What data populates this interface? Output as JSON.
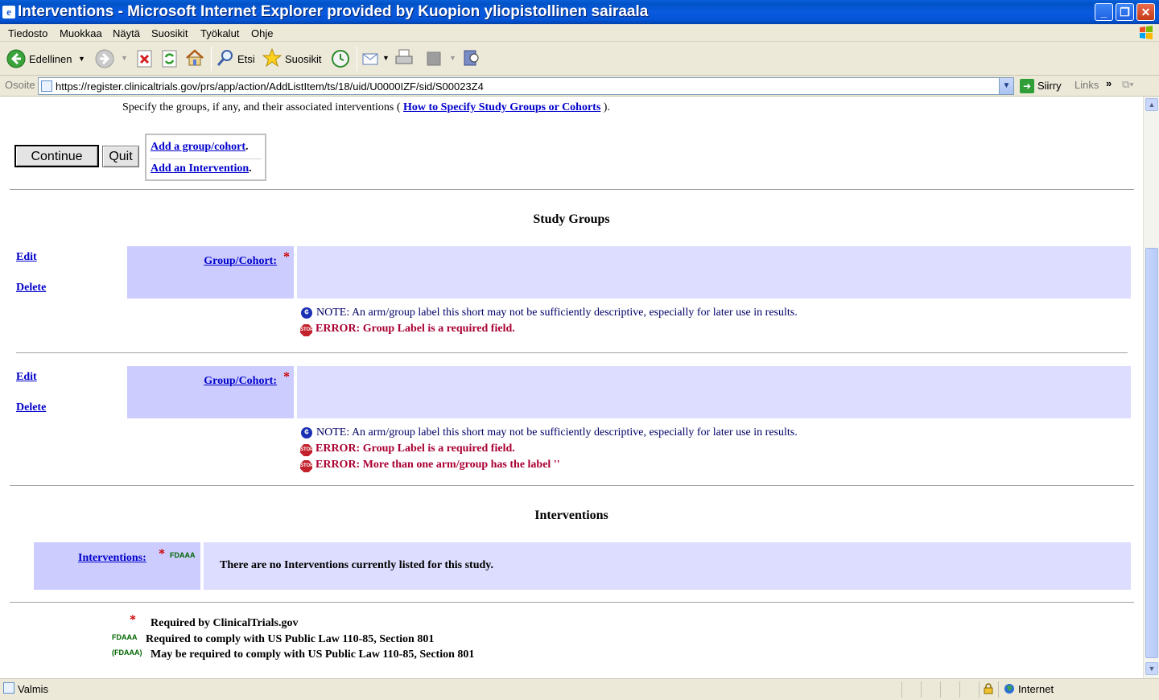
{
  "window": {
    "title": "Interventions - Microsoft Internet Explorer provided by Kuopion yliopistollinen sairaala"
  },
  "menu": [
    "Tiedosto",
    "Muokkaa",
    "Näytä",
    "Suosikit",
    "Työkalut",
    "Ohje"
  ],
  "toolbar": {
    "back_label": "Edellinen",
    "search_label": "Etsi",
    "favorites_label": "Suosikit"
  },
  "address": {
    "label": "Osoite",
    "url": "https://register.clinicaltrials.gov/prs/app/action/AddListItem/ts/18/uid/U0000IZF/sid/S00023Z4",
    "go_label": "Siirry",
    "links_label": "Links"
  },
  "page": {
    "intro_text": "Specify the groups, if any, and their associated interventions (",
    "intro_link": "How to Specify Study Groups or Cohorts",
    "intro_end": ").",
    "continue_label": "Continue",
    "quit_label": "Quit",
    "add_group_link": "Add a group/cohort",
    "add_intervention_link": "Add an Intervention",
    "period": ".",
    "study_groups_title": "Study Groups",
    "groups": [
      {
        "edit_label": "Edit",
        "delete_label": "Delete",
        "field_label": "Group/Cohort:",
        "required_mark": "*",
        "value": "",
        "note": "NOTE: An arm/group label this short may not be sufficiently descriptive, especially for later use in results.",
        "errors": [
          "ERROR: Group Label is a required field."
        ]
      },
      {
        "edit_label": "Edit",
        "delete_label": "Delete",
        "field_label": "Group/Cohort:",
        "required_mark": "*",
        "value": "",
        "note": "NOTE: An arm/group label this short may not be sufficiently descriptive, especially for later use in results.",
        "errors": [
          "ERROR: Group Label is a required field.",
          "ERROR: More than one arm/group has the label ''"
        ]
      }
    ],
    "interventions_title": "Interventions",
    "interventions_label": "Interventions:",
    "interventions_required": "*",
    "interventions_fdaaa": "FDAAA",
    "interventions_empty": "There are no Interventions currently listed for this study.",
    "legend": {
      "required_mark": "*",
      "required_text": "Required by ClinicalTrials.gov",
      "fdaaa_mark": "FDAAA",
      "fdaaa_text": "Required to comply with US Public Law 110-85, Section 801",
      "fdaaa_opt_mark": "(FDAAA)",
      "fdaaa_opt_text": "May be required to comply with US Public Law 110-85, Section 801"
    }
  },
  "status": {
    "text": "Valmis",
    "zone": "Internet"
  }
}
